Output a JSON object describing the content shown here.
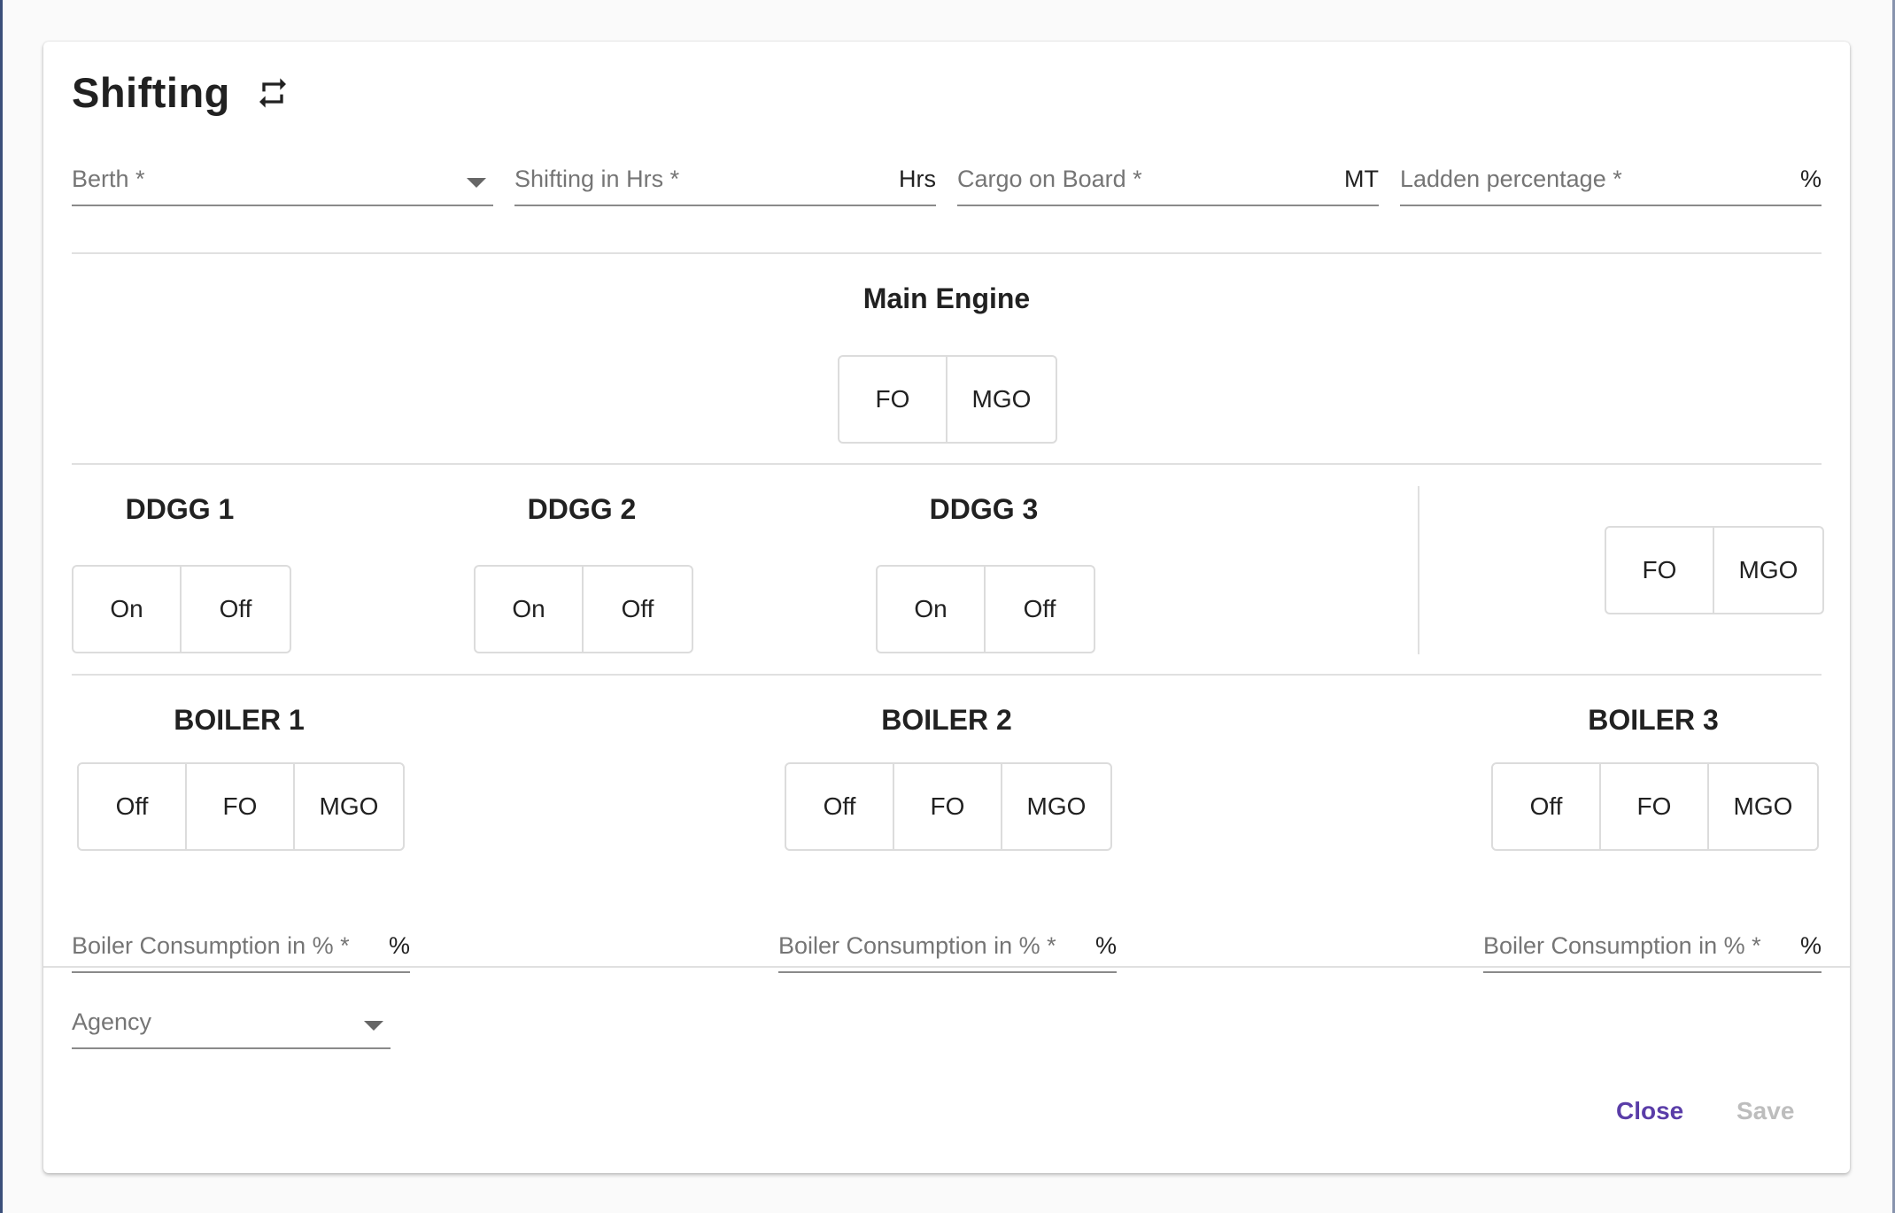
{
  "dialog": {
    "title": "Shifting",
    "title_icon": "swap-horiz-icon"
  },
  "top_fields": {
    "berth": {
      "label": "Berth *",
      "value": ""
    },
    "shifting_hrs": {
      "label": "Shifting in Hrs *",
      "suffix": "Hrs",
      "value": ""
    },
    "cargo_on_board": {
      "label": "Cargo on Board *",
      "suffix": "MT",
      "value": ""
    },
    "ladden_percentage": {
      "label": "Ladden percentage *",
      "suffix": "%",
      "value": ""
    }
  },
  "main_engine": {
    "heading": "Main Engine",
    "options": [
      "FO",
      "MGO"
    ]
  },
  "ddgg": [
    {
      "heading": "DDGG 1",
      "options": [
        "On",
        "Off"
      ]
    },
    {
      "heading": "DDGG 2",
      "options": [
        "On",
        "Off"
      ]
    },
    {
      "heading": "DDGG 3",
      "options": [
        "On",
        "Off"
      ]
    }
  ],
  "ddgg_fuel": {
    "options": [
      "FO",
      "MGO"
    ]
  },
  "boilers": [
    {
      "heading": "BOILER 1",
      "options": [
        "Off",
        "FO",
        "MGO"
      ],
      "consumption_label": "Boiler Consumption in % *",
      "suffix": "%"
    },
    {
      "heading": "BOILER 2",
      "options": [
        "Off",
        "FO",
        "MGO"
      ],
      "consumption_label": "Boiler Consumption in % *",
      "suffix": "%"
    },
    {
      "heading": "BOILER 3",
      "options": [
        "Off",
        "FO",
        "MGO"
      ],
      "consumption_label": "Boiler Consumption in % *",
      "suffix": "%"
    }
  ],
  "agency": {
    "label": "Agency",
    "value": ""
  },
  "actions": {
    "close_label": "Close",
    "save_label": "Save"
  },
  "colors": {
    "primary": "#5a3da8",
    "disabled": "#bdbdbd",
    "border": "#dcdcdc"
  }
}
